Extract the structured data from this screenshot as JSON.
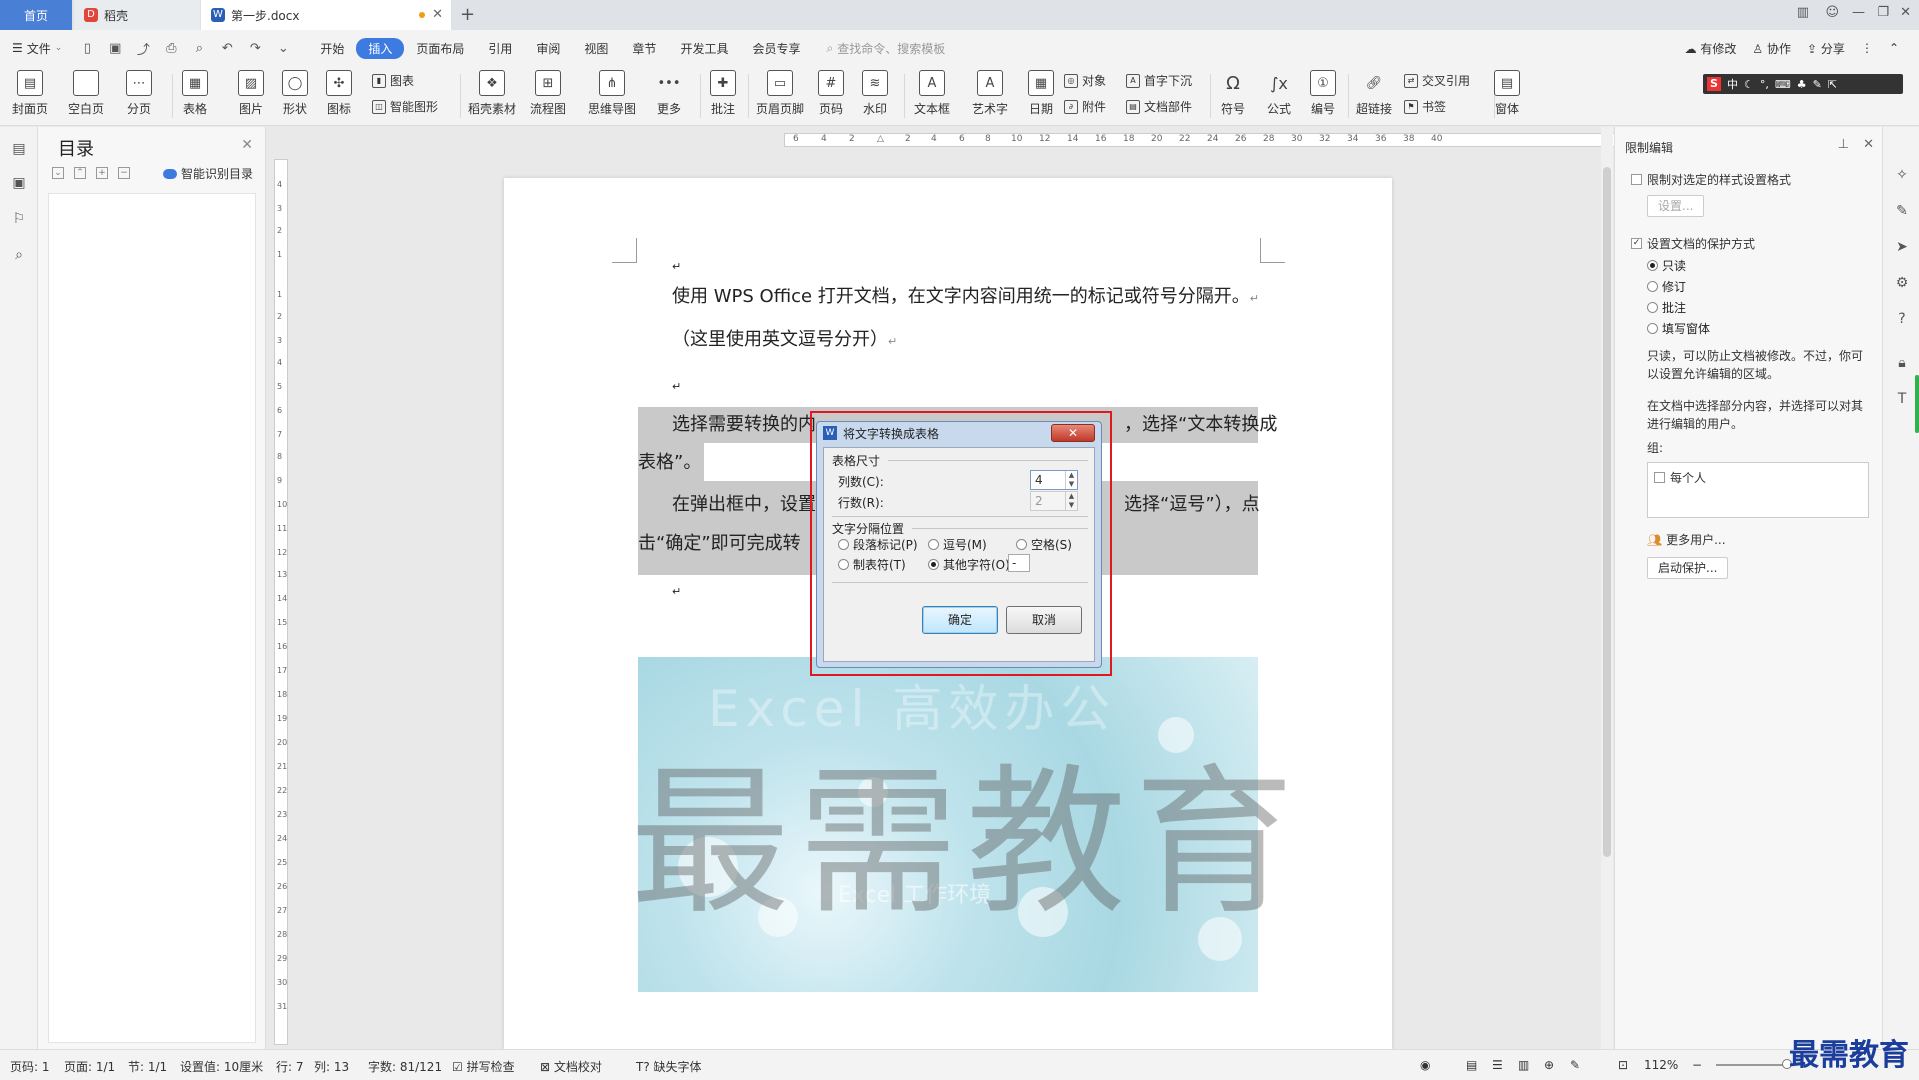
{
  "titlebar": {
    "tabs": [
      {
        "label": "首页"
      },
      {
        "label": "稻壳"
      },
      {
        "label": "第一步.docx"
      }
    ]
  },
  "menubar": {
    "file_label": "文件",
    "tabs": [
      "开始",
      "插入",
      "页面布局",
      "引用",
      "审阅",
      "视图",
      "章节",
      "开发工具",
      "会员专享"
    ],
    "active_tab": "插入",
    "search_placeholder": "查找命令、搜索模板",
    "right": [
      "有修改",
      "协作",
      "分享"
    ]
  },
  "ribbon": {
    "big_buttons": [
      "封面页",
      "空白页",
      "分页",
      "表格",
      "图片",
      "形状",
      "图标",
      "稻壳素材",
      "流程图",
      "思维导图",
      "更多",
      "批注",
      "页眉页脚",
      "页码",
      "水印",
      "文本框",
      "艺术字",
      "日期",
      "符号",
      "公式",
      "编号",
      "超链接",
      "窗体"
    ],
    "small_buttons": [
      "图表",
      "智能图形",
      "对象",
      "附件",
      "首字下沉",
      "文档部件",
      "交叉引用",
      "书签"
    ],
    "ime_text": "中"
  },
  "toc": {
    "title": "目录",
    "smart_label": "智能识别目录"
  },
  "document": {
    "paragraphs": [
      "使用 WPS Office 打开文档，在文字内容间用统一的标记或符号分隔开。",
      "（这里使用英文逗号分开）",
      "选择需要转换的内",
      "，选择“文本转换成",
      "表格”。",
      "在弹出框中，设置",
      "选择“逗号”），点",
      "击“确定”即可完成转"
    ],
    "banner_en": "Excel 高效办公",
    "banner_sub": "Excel 工作环境",
    "watermark": "最需教育"
  },
  "dialog": {
    "title": "将文字转换成表格",
    "group1": "表格尺寸",
    "cols_label": "列数(C):",
    "cols_value": "4",
    "rows_label": "行数(R):",
    "rows_value": "2",
    "group2": "文字分隔位置",
    "radio_para": "段落标记(P)",
    "radio_comma": "逗号(M)",
    "radio_space": "空格(S)",
    "radio_tab": "制表符(T)",
    "radio_other": "其他字符(O):",
    "other_char": "-",
    "ok_label": "确定",
    "cancel_label": "取消",
    "selected_separator": "其他字符"
  },
  "right_panel": {
    "title": "限制编辑",
    "restrict_format_label": "限制对选定的样式设置格式",
    "settings_button": "设置...",
    "protect_label": "设置文档的保护方式",
    "modes": [
      "只读",
      "修订",
      "批注",
      "填写窗体"
    ],
    "selected_mode": "只读",
    "desc1": "只读，可以防止文档被修改。不过，你可以设置允许编辑的区域。",
    "desc2": "在文档中选择部分内容，并选择可以对其进行编辑的用户。",
    "group_label": "组:",
    "everyone_label": "每个人",
    "more_users": "更多用户...",
    "start_protect": "启动保护..."
  },
  "statusbar": {
    "page_code": "页码: 1",
    "page": "页面: 1/1",
    "section": "节: 1/1",
    "setting": "设置值: 10厘米",
    "row": "行: 7",
    "col": "列: 13",
    "words": "字数: 81/121",
    "spell": "拼写检查",
    "proof": "文档校对",
    "missing_font": "缺失字体",
    "zoom": "112%"
  },
  "brand_mark": "最需教育",
  "colors": {
    "accent": "#3d7be0",
    "selection": "#c9c9c9",
    "frame_red": "#e0181f",
    "status_green": "#2fb24c"
  }
}
